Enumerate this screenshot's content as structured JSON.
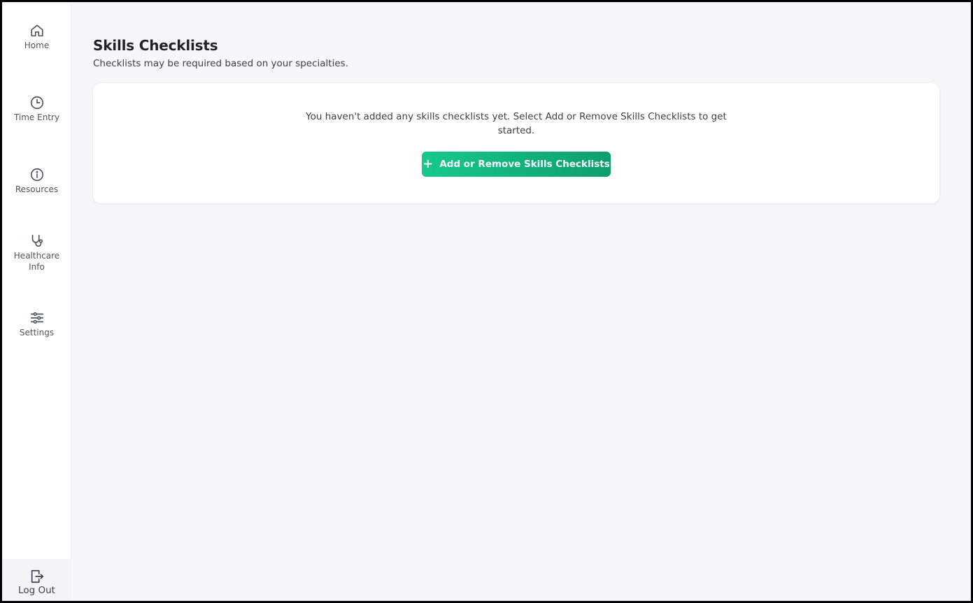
{
  "nav": {
    "home": {
      "label": "Home",
      "icon": "home-icon"
    },
    "time_entry": {
      "label": "Time Entry",
      "icon": "clock-icon"
    },
    "resources": {
      "label": "Resources",
      "icon": "info-icon"
    },
    "healthcare_info": {
      "label": "Healthcare Info",
      "icon": "stethoscope-icon"
    },
    "settings": {
      "label": "Settings",
      "icon": "sliders-icon"
    },
    "logout": {
      "label": "Log Out",
      "icon": "logout-icon"
    }
  },
  "page": {
    "title": "Skills Checklists",
    "subtitle": "Checklists may be required based on your specialties."
  },
  "empty_state": {
    "message": "You haven't added any skills checklists yet. Select Add or Remove Skills Checklists to get started.",
    "button_label": "Add or Remove Skills Checklists",
    "button_icon": "plus-icon"
  },
  "colors": {
    "accent_start": "#15c98c",
    "accent_end": "#0f9e6e",
    "background": "#f6f7f9"
  }
}
